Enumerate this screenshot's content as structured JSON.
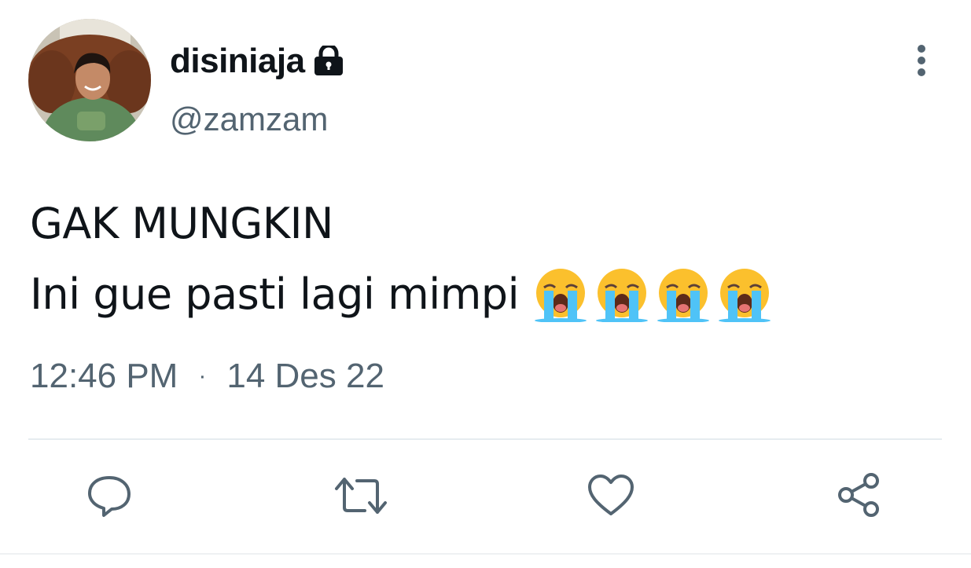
{
  "user": {
    "display_name": "disiniaja",
    "handle": "@zamzam",
    "avatar_icon": "profile-photo",
    "protected_icon": "lock-icon"
  },
  "tweet": {
    "line1": "GAK MUNGKIN",
    "line2": "Ini gue pasti lagi mimpi",
    "emoji": "loudly-crying-face",
    "emoji_count": 4
  },
  "meta": {
    "time": "12:46 PM",
    "separator": "·",
    "date": "14 Des 22"
  },
  "actions": {
    "reply_icon": "reply-icon",
    "retweet_icon": "retweet-icon",
    "like_icon": "heart-icon",
    "share_icon": "share-icon"
  },
  "colors": {
    "text_primary": "#0f1419",
    "text_secondary": "#536471",
    "divider": "#e6ecf0"
  }
}
